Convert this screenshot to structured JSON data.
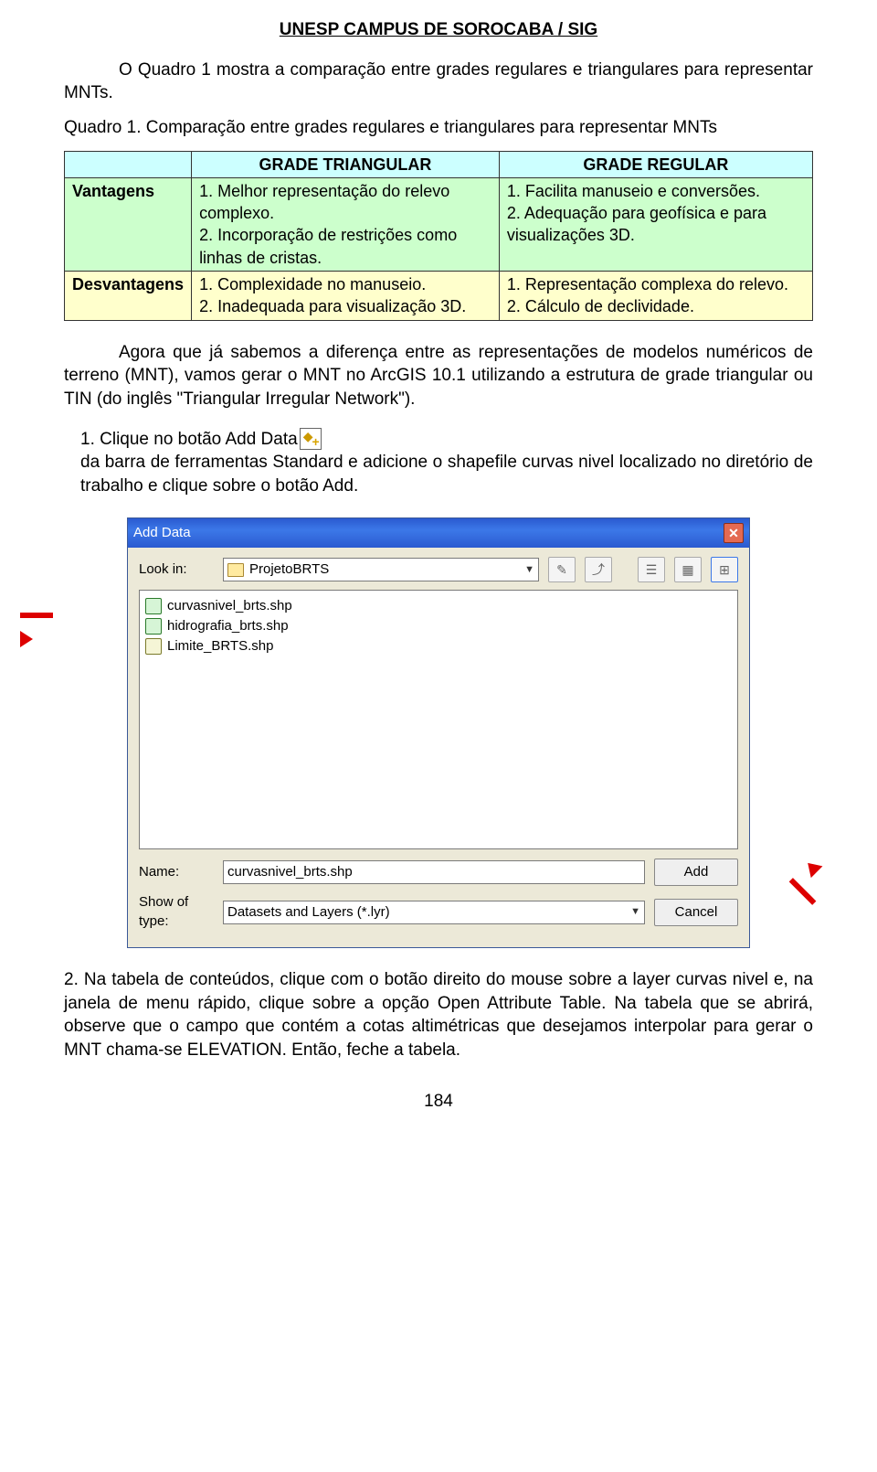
{
  "header": "UNESP CAMPUS DE SOROCABA / SIG",
  "intro": "O Quadro 1 mostra a comparação entre grades regulares e triangulares para representar MNTs.",
  "quadro_caption_a": "Quadro 1. ",
  "quadro_caption_b": "Comparação entre grades regulares e triangulares para representar MNTs",
  "table": {
    "htri": "GRADE TRIANGULAR",
    "hreg": "GRADE REGULAR",
    "vant": "Vantagens",
    "v1a": "1. Melhor representação do relevo complexo.",
    "v1b": "2. Incorporação de restrições como linhas de cristas.",
    "v2a": "1. Facilita manuseio e conversões.",
    "v2b": "2. Adequação para geofísica e para visualizações 3D.",
    "desv": "Desvantagens",
    "d1a": "1. Complexidade no manuseio.",
    "d1b": "2. Inadequada para visualização 3D.",
    "d2a": "1. Representação complexa do relevo.",
    "d2b": "2. Cálculo de declividade."
  },
  "p2": "Agora que já sabemos a diferença entre as representações de modelos numéricos de terreno (MNT), vamos gerar o MNT no ArcGIS 10.1 utilizando a estrutura de grade triangular ou TIN (do inglês \"Triangular Irregular Network\").",
  "step1_a": "1. Clique no botão Add Data ",
  "step1_b": " da barra de ferramentas Standard e adicione o shapefile curvas nivel localizado no diretório de trabalho e clique sobre o botão Add.",
  "dialog": {
    "title": "Add Data",
    "lookin": "Look in:",
    "folder": "ProjetoBRTS",
    "files": [
      "curvasnivel_brts.shp",
      "hidrografia_brts.shp",
      "Limite_BRTS.shp"
    ],
    "name_lab": "Name:",
    "name_val": "curvasnivel_brts.shp",
    "type_lab": "Show of type:",
    "type_val": "Datasets and Layers (*.lyr)",
    "add": "Add",
    "cancel": "Cancel"
  },
  "step2": "2. Na tabela de conteúdos, clique com o botão direito do mouse sobre a layer curvas nivel e, na janela de menu rápido, clique sobre a opção Open Attribute Table. Na tabela que se abrirá, observe que o campo que contém a cotas altimétricas que desejamos interpolar para gerar o MNT chama-se ELEVATION. Então, feche a tabela.",
  "pagenum": "184"
}
